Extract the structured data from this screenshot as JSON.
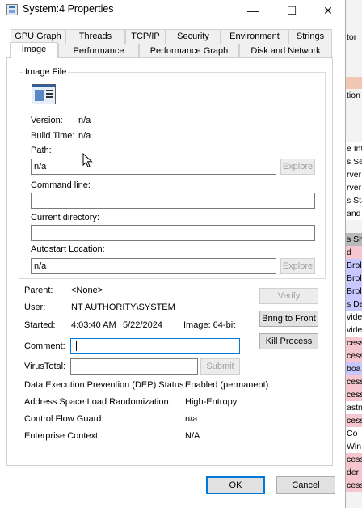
{
  "window": {
    "title": "System:4 Properties",
    "controls": {
      "minimize": "—",
      "maximize": "☐",
      "close": "✕"
    }
  },
  "tabs": {
    "row1": [
      "GPU Graph",
      "Threads",
      "TCP/IP",
      "Security",
      "Environment",
      "Strings"
    ],
    "row2": [
      "Image",
      "Performance",
      "Performance Graph",
      "Disk and Network"
    ],
    "selected": "Image"
  },
  "image_file": {
    "group_label": "Image File",
    "version_label": "Version:",
    "version_value": "n/a",
    "build_time_label": "Build Time:",
    "build_time_value": "n/a",
    "path_label": "Path:",
    "path_value": "n/a",
    "explore_label": "Explore",
    "command_line_label": "Command line:",
    "command_line_value": "",
    "current_directory_label": "Current directory:",
    "current_directory_value": "",
    "autostart_label": "Autostart Location:",
    "autostart_value": "n/a",
    "explore2_label": "Explore"
  },
  "details": {
    "parent_label": "Parent:",
    "parent_value": "<None>",
    "user_label": "User:",
    "user_value": "NT AUTHORITY\\SYSTEM",
    "started_label": "Started:",
    "started_time": "4:03:40 AM",
    "started_date": "5/22/2024",
    "image_bits": "Image: 64-bit",
    "comment_label": "Comment:",
    "comment_value": "",
    "virustotal_label": "VirusTotal:",
    "virustotal_value": "",
    "submit_label": "Submit",
    "dep_label": "Data Execution Prevention (DEP) Status:",
    "dep_value": "Enabled (permanent)",
    "aslr_label": "Address Space Load Randomization:",
    "aslr_value": "High-Entropy",
    "cfg_label": "Control Flow Guard:",
    "cfg_value": "n/a",
    "enterprise_label": "Enterprise Context:",
    "enterprise_value": "N/A"
  },
  "actions": {
    "verify": "Verify",
    "bring_to_front": "Bring to Front",
    "kill_process": "Kill Process"
  },
  "footer": {
    "ok": "OK",
    "cancel": "Cancel"
  },
  "background_list": {
    "rows": [
      {
        "text": "tor",
        "color": "#f3f3f3"
      },
      {
        "text": "",
        "color": "#f0c8b4"
      },
      {
        "text": "tion",
        "color": "#f3f3f3"
      },
      {
        "text": "e Int",
        "color": "#ffffff"
      },
      {
        "text": "s Se",
        "color": "#ffffff"
      },
      {
        "text": "rver",
        "color": "#ffffff"
      },
      {
        "text": "rver",
        "color": "#ffffff"
      },
      {
        "text": "s Sta",
        "color": "#ffffff"
      },
      {
        "text": "and",
        "color": "#ffffff"
      },
      {
        "text": "s Sh",
        "color": "#b9b9b9"
      },
      {
        "text": "d",
        "color": "#f6c6ce"
      },
      {
        "text": "Brol",
        "color": "#c8c8ff"
      },
      {
        "text": "Brol",
        "color": "#c8c8ff"
      },
      {
        "text": "Brol",
        "color": "#c8c8ff"
      },
      {
        "text": "s De",
        "color": "#c8c8ff"
      },
      {
        "text": "vide",
        "color": "#ffffff"
      },
      {
        "text": "vide",
        "color": "#ffffff"
      },
      {
        "text": "cess",
        "color": "#f6c6ce"
      },
      {
        "text": "cess",
        "color": "#f6c6ce"
      },
      {
        "text": "boa",
        "color": "#c8c8ff"
      },
      {
        "text": "cess",
        "color": "#f6c6ce"
      },
      {
        "text": "cess",
        "color": "#f6c6ce"
      },
      {
        "text": "astn",
        "color": "#ffffff"
      },
      {
        "text": "cess",
        "color": "#f6c6ce"
      },
      {
        "text": "Co",
        "color": "#ffffff"
      },
      {
        "text": "Win",
        "color": "#ffffff"
      },
      {
        "text": "cess",
        "color": "#f6c6ce"
      },
      {
        "text": "der",
        "color": "#f6c6ce"
      },
      {
        "text": "cess",
        "color": "#f6c6ce"
      }
    ]
  }
}
